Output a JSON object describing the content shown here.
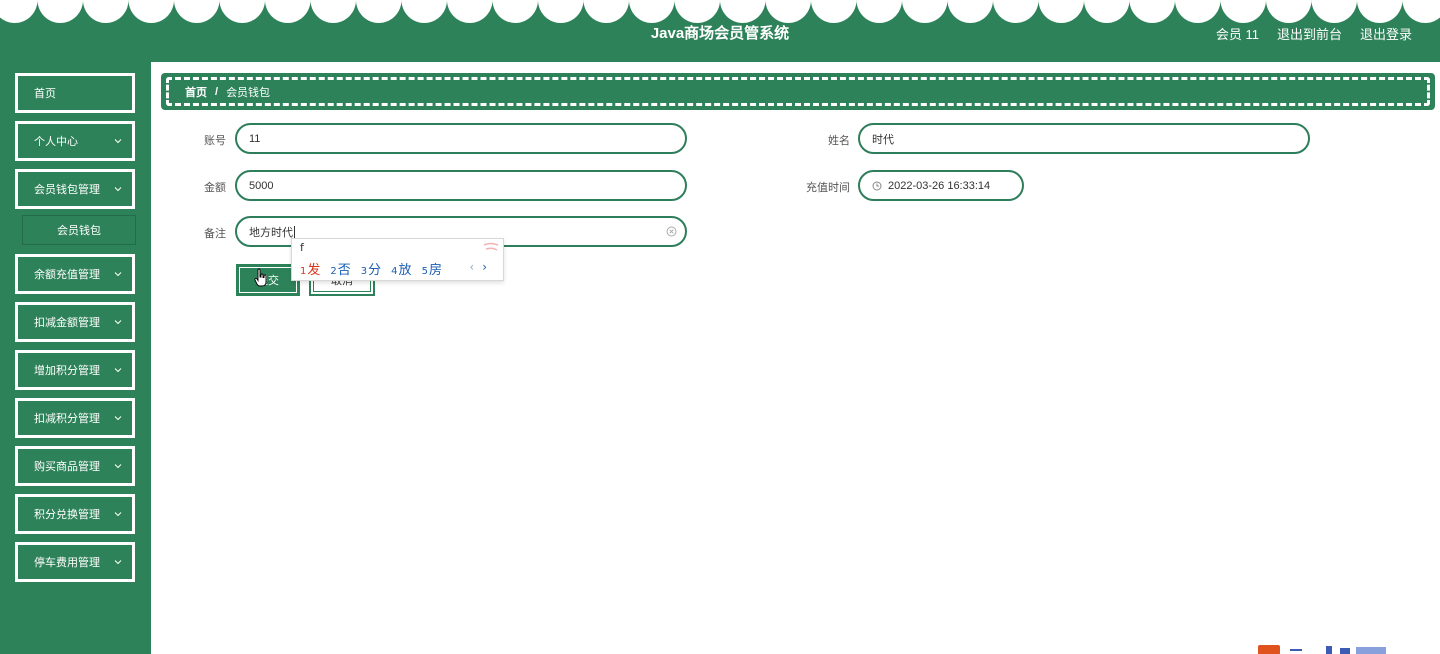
{
  "header": {
    "title": "Java商场会员管系统",
    "links": [
      "会员 11",
      "退出到前台",
      "退出登录"
    ]
  },
  "sidebar": {
    "items": [
      {
        "label": "首页",
        "has_chevron": false
      },
      {
        "label": "个人中心",
        "has_chevron": true
      },
      {
        "label": "会员钱包管理",
        "has_chevron": true,
        "expanded": true
      },
      {
        "label": "余额充值管理",
        "has_chevron": true
      },
      {
        "label": "扣减金额管理",
        "has_chevron": true
      },
      {
        "label": "增加积分管理",
        "has_chevron": true
      },
      {
        "label": "扣减积分管理",
        "has_chevron": true
      },
      {
        "label": "购买商品管理",
        "has_chevron": true
      },
      {
        "label": "积分兑换管理",
        "has_chevron": true
      },
      {
        "label": "停车费用管理",
        "has_chevron": true
      }
    ],
    "submenu": {
      "label": "会员钱包"
    }
  },
  "breadcrumb": {
    "home": "首页",
    "separator": "/",
    "current": "会员钱包"
  },
  "form": {
    "account": {
      "label": "账号",
      "value": "11"
    },
    "name": {
      "label": "姓名",
      "value": "时代"
    },
    "amount": {
      "label": "金额",
      "value": "5000"
    },
    "recharge_time": {
      "label": "充值时间",
      "value": "2022-03-26 16:33:14"
    },
    "remark": {
      "label": "备注",
      "value": "地方时代"
    },
    "submit_label": "提交",
    "cancel_label": "取消"
  },
  "ime": {
    "composition": "f",
    "candidates": [
      {
        "num": "1",
        "text": "发"
      },
      {
        "num": "2",
        "text": "否"
      },
      {
        "num": "3",
        "text": "分"
      },
      {
        "num": "4",
        "text": "放"
      },
      {
        "num": "5",
        "text": "房"
      }
    ],
    "prev": "‹",
    "next": "›"
  },
  "colors": {
    "primary": "#2e8259",
    "white": "#ffffff",
    "accent_red": "#d9341a",
    "ime_blue": "#1a5fb4"
  },
  "icons": [
    "chevron-down-icon",
    "clock-icon",
    "clear-icon",
    "hand-cursor-icon"
  ]
}
